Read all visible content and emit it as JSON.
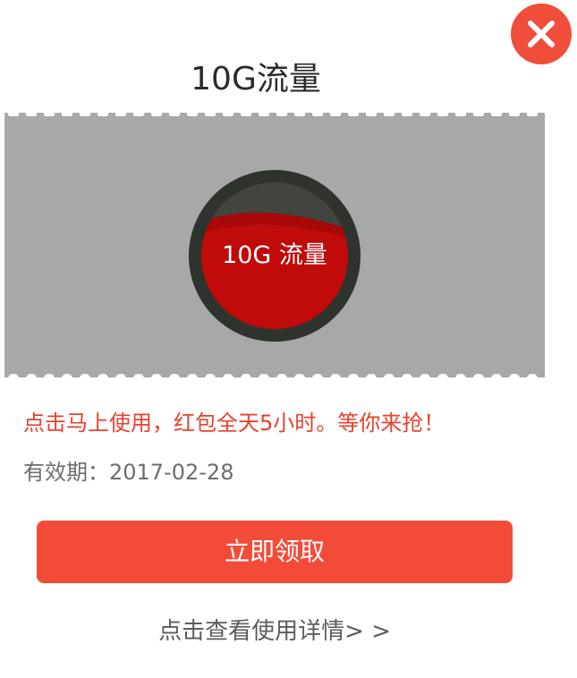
{
  "dialog": {
    "title": "10G流量",
    "close_icon": "close-icon"
  },
  "coupon": {
    "badge_text": "10G 流量"
  },
  "promo_text": "点击马上使用，红包全天5小时。等你来抢！",
  "validity_text": "有效期：2017-02-28",
  "claim_button_label": "立即领取",
  "details_link_label": "点击查看使用详情> >",
  "colors": {
    "accent": "#f24c38",
    "promo_text": "#e8412e",
    "ticket_background": "#a8a8a8",
    "badge_red": "#c10a0a"
  }
}
